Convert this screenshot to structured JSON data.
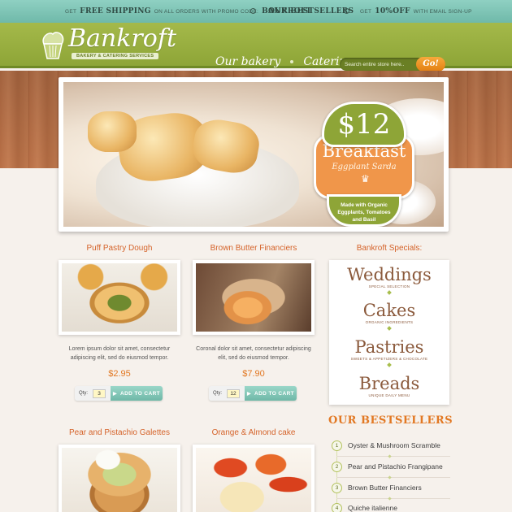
{
  "topbar": {
    "shipping_get": "GET",
    "shipping_big": "FREE SHIPPING",
    "shipping_rest": "ON ALL ORDERS WITH PROMO CODE:",
    "promo_code": "BANKROFT",
    "bestsellers": "OUR BESTSELLERS",
    "discount_get": "GET",
    "discount_big": "10%OFF",
    "discount_rest": "WITH EMAIL SIGN-UP"
  },
  "header": {
    "brand": "Bankroft",
    "tagline": "BAKERY & CATERING SERVICES",
    "nav": [
      "Our bakery",
      "Catering"
    ],
    "search_placeholder": "Search entire store here..",
    "search_button": "Go!"
  },
  "hero": {
    "price": "$12",
    "title": "Breakfast",
    "subtitle": "Eggplant Sarda",
    "description": "Made with Organic Eggplants, Tomatoes and Basil"
  },
  "products": [
    {
      "name": "Puff Pastry Dough",
      "description": "Lorem ipsum dolor sit amet, consectetur adipiscing elit, sed do eiusmod tempor.",
      "price": "$2.95",
      "qty": "3"
    },
    {
      "name": "Brown Butter Financiers",
      "description": "Coronal dolor sit amet, consectetur adipiscing elit, sed do eiusmod tempor.",
      "price": "$7.90",
      "qty": "12"
    },
    {
      "name": "Pear and Pistachio Galettes"
    },
    {
      "name": "Orange & Almond cake"
    }
  ],
  "cart": {
    "qty_label": "Qty:",
    "add_label": "ADD TO CART"
  },
  "specials": {
    "title": "Bankroft Specials:",
    "items": [
      {
        "name": "Weddings",
        "sub": "SPECIAL SELECTION"
      },
      {
        "name": "Cakes",
        "sub": "ORGANIC INGREDIENTS"
      },
      {
        "name": "Pastries",
        "sub": "SWEETS & APPETIZERS & CHOCOLATE"
      },
      {
        "name": "Breads",
        "sub": "UNIQUE DAILY MENU"
      }
    ]
  },
  "bestsellers": {
    "title": "OUR BESTSELLERS",
    "items": [
      {
        "num": "1",
        "name": "Oyster & Mushroom Scramble"
      },
      {
        "num": "2",
        "name": "Pear and Pistachio Frangipane"
      },
      {
        "num": "3",
        "name": "Brown Butter Financiers"
      },
      {
        "num": "4",
        "name": "Quiche italienne"
      }
    ]
  },
  "colors": {
    "accent_green": "#8ea537",
    "accent_orange": "#e27823",
    "teal": "#7cc3b3"
  }
}
